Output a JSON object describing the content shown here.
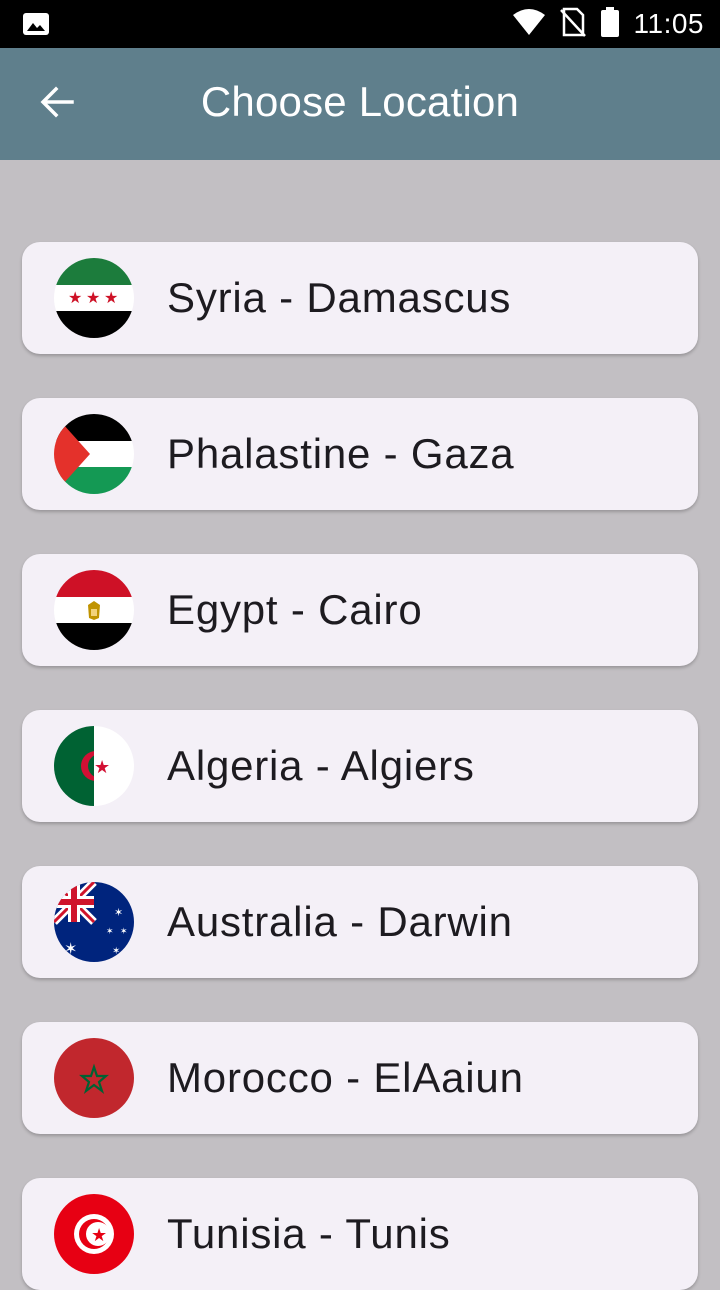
{
  "status_bar": {
    "time": "11:05"
  },
  "app_bar": {
    "title": "Choose Location"
  },
  "locations": [
    {
      "label": "Syria - Damascus",
      "flag": "syria-flag-icon"
    },
    {
      "label": "Phalastine - Gaza",
      "flag": "palestine-flag-icon"
    },
    {
      "label": "Egypt - Cairo",
      "flag": "egypt-flag-icon"
    },
    {
      "label": "Algeria - Algiers",
      "flag": "algeria-flag-icon"
    },
    {
      "label": "Australia - Darwin",
      "flag": "australia-flag-icon"
    },
    {
      "label": "Morocco - ElAaiun",
      "flag": "morocco-flag-icon"
    },
    {
      "label": "Tunisia - Tunis",
      "flag": "tunisia-flag-icon"
    }
  ],
  "colors": {
    "app_bar": "#5f7f8c",
    "background": "#c2bfc3",
    "card": "#f4f0f7"
  }
}
